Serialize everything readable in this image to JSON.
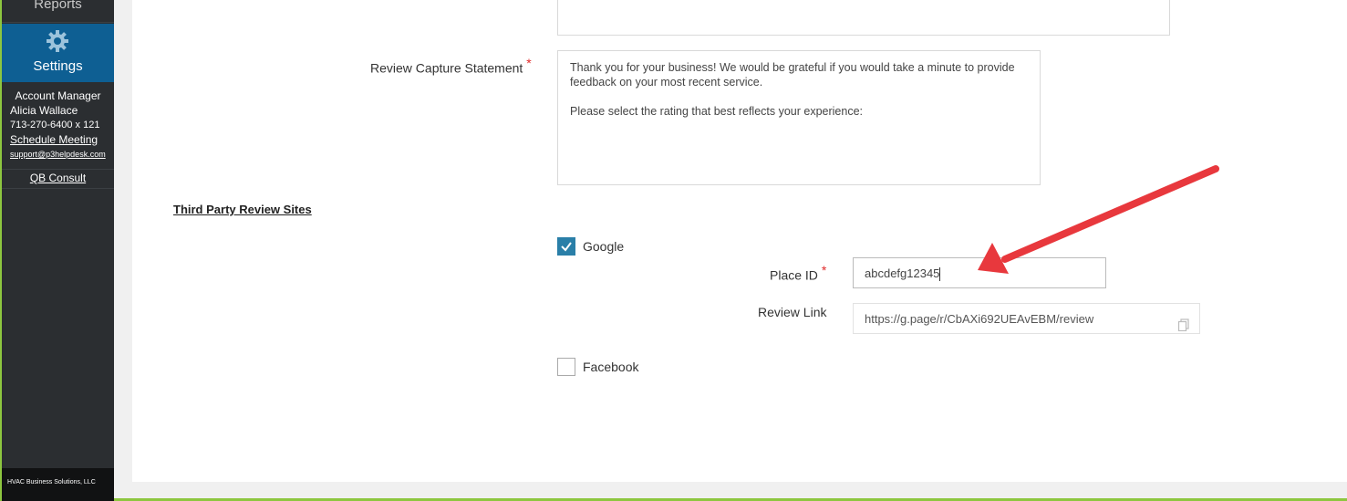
{
  "sidebar": {
    "reports_label": "Reports",
    "settings_label": "Settings",
    "account": {
      "title": "Account Manager",
      "name": "Alicia Wallace",
      "phone": "713-270-6400 x 121",
      "meeting_link": "Schedule Meeting",
      "email": "support@p3helpdesk.com"
    },
    "qb_consult": "QB Consult",
    "footer": "HVAC Business Solutions, LLC"
  },
  "form": {
    "statement_label": "Review Capture Statement",
    "required_mark": "*",
    "statement_text": "Thank you for your business! We would be grateful if you would take a minute to provide\nfeedback on your most recent service.\n\nPlease select the rating that best reflects your experience:",
    "section_title": "Third Party Review Sites",
    "google_label": "Google",
    "google_checked": true,
    "place_id_label": "Place ID",
    "place_id_value": "abcdefg12345",
    "review_link_label": "Review Link",
    "review_link_value": "https://g.page/r/CbAXi692UEAvEBM/review",
    "facebook_label": "Facebook",
    "facebook_checked": false
  },
  "colors": {
    "sidebar_bg": "#2b2e31",
    "settings_active_bg": "#0e5f93",
    "accent_green": "#8dc63f",
    "checkbox_blue": "#2a7fa8",
    "annotation_arrow": "#e8383d"
  },
  "icons": {
    "settings": "gear-icon",
    "copy": "copy-icon",
    "check": "checkmark-icon"
  }
}
